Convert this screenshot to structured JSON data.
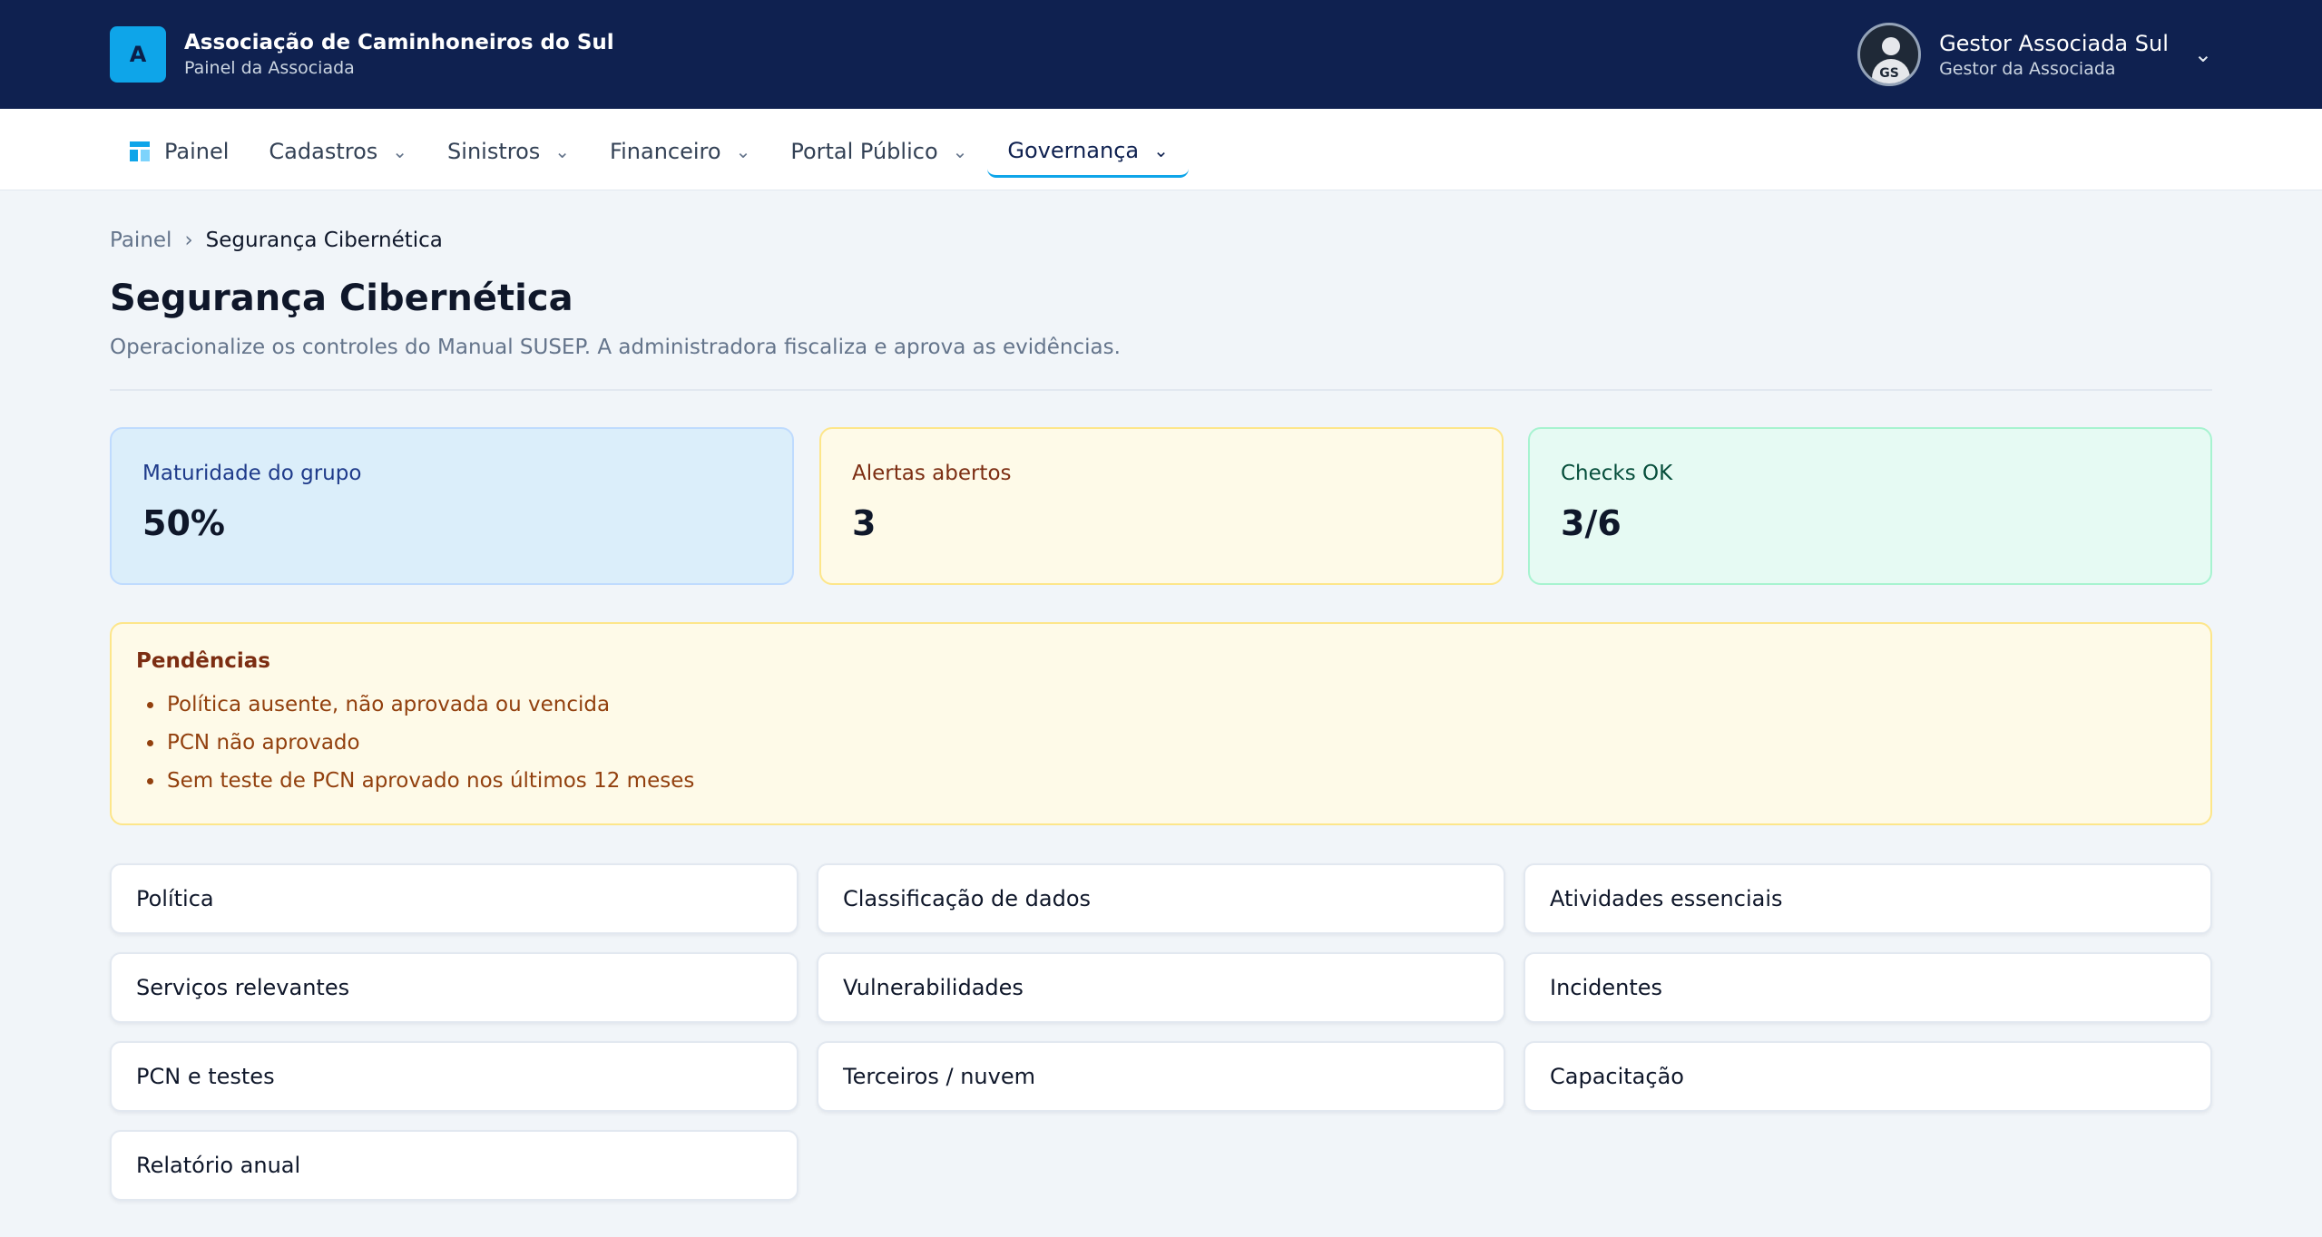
{
  "header": {
    "logo_letter": "A",
    "title": "Associação de Caminhoneiros do Sul",
    "subtitle": "Painel da Associada",
    "user": {
      "initials": "GS",
      "name": "Gestor Associada Sul",
      "role": "Gestor da Associada",
      "chevron": "chevron-down-icon"
    }
  },
  "nav": {
    "items": [
      {
        "label": "Painel",
        "icon": "dashboard-icon"
      },
      {
        "label": "Cadastros",
        "icon": "chevron-down-icon"
      },
      {
        "label": "Sinistros",
        "icon": "chevron-down-icon"
      },
      {
        "label": "Financeiro",
        "icon": "chevron-down-icon"
      },
      {
        "label": "Portal Público",
        "icon": "chevron-down-icon"
      },
      {
        "label": "Governança",
        "icon": "chevron-down-icon",
        "active": true
      }
    ]
  },
  "breadcrumb": {
    "root": "Painel",
    "separator": "›",
    "current": "Segurança Cibernética"
  },
  "page": {
    "title": "Segurança Cibernética",
    "description": "Operacionalize os controles do Manual SUSEP. A administradora fiscaliza e aprova as evidências."
  },
  "stats": [
    {
      "label": "Maturidade do grupo",
      "value": "50%",
      "color": "#dbeefa"
    },
    {
      "label": "Alertas abertos",
      "value": "3",
      "color": "#fefae8"
    },
    {
      "label": "Checks OK",
      "value": "3/6",
      "color": "#e6faf3"
    }
  ],
  "pending": {
    "title": "Pendências",
    "items": [
      "Política ausente, não aprovada ou vencida",
      "PCN não aprovado",
      "Sem teste de PCN aprovado nos últimos 12 meses"
    ]
  },
  "controls": [
    "Política",
    "Classificação de dados",
    "Atividades essenciais",
    "Serviços relevantes",
    "Vulnerabilidades",
    "Incidentes",
    "PCN e testes",
    "Terceiros / nuvem",
    "Capacitação",
    "Relatório anual"
  ],
  "colors": {
    "header_bg": "#0f2150",
    "accent": "#0ea5e9",
    "page_bg": "#f1f5f9"
  }
}
